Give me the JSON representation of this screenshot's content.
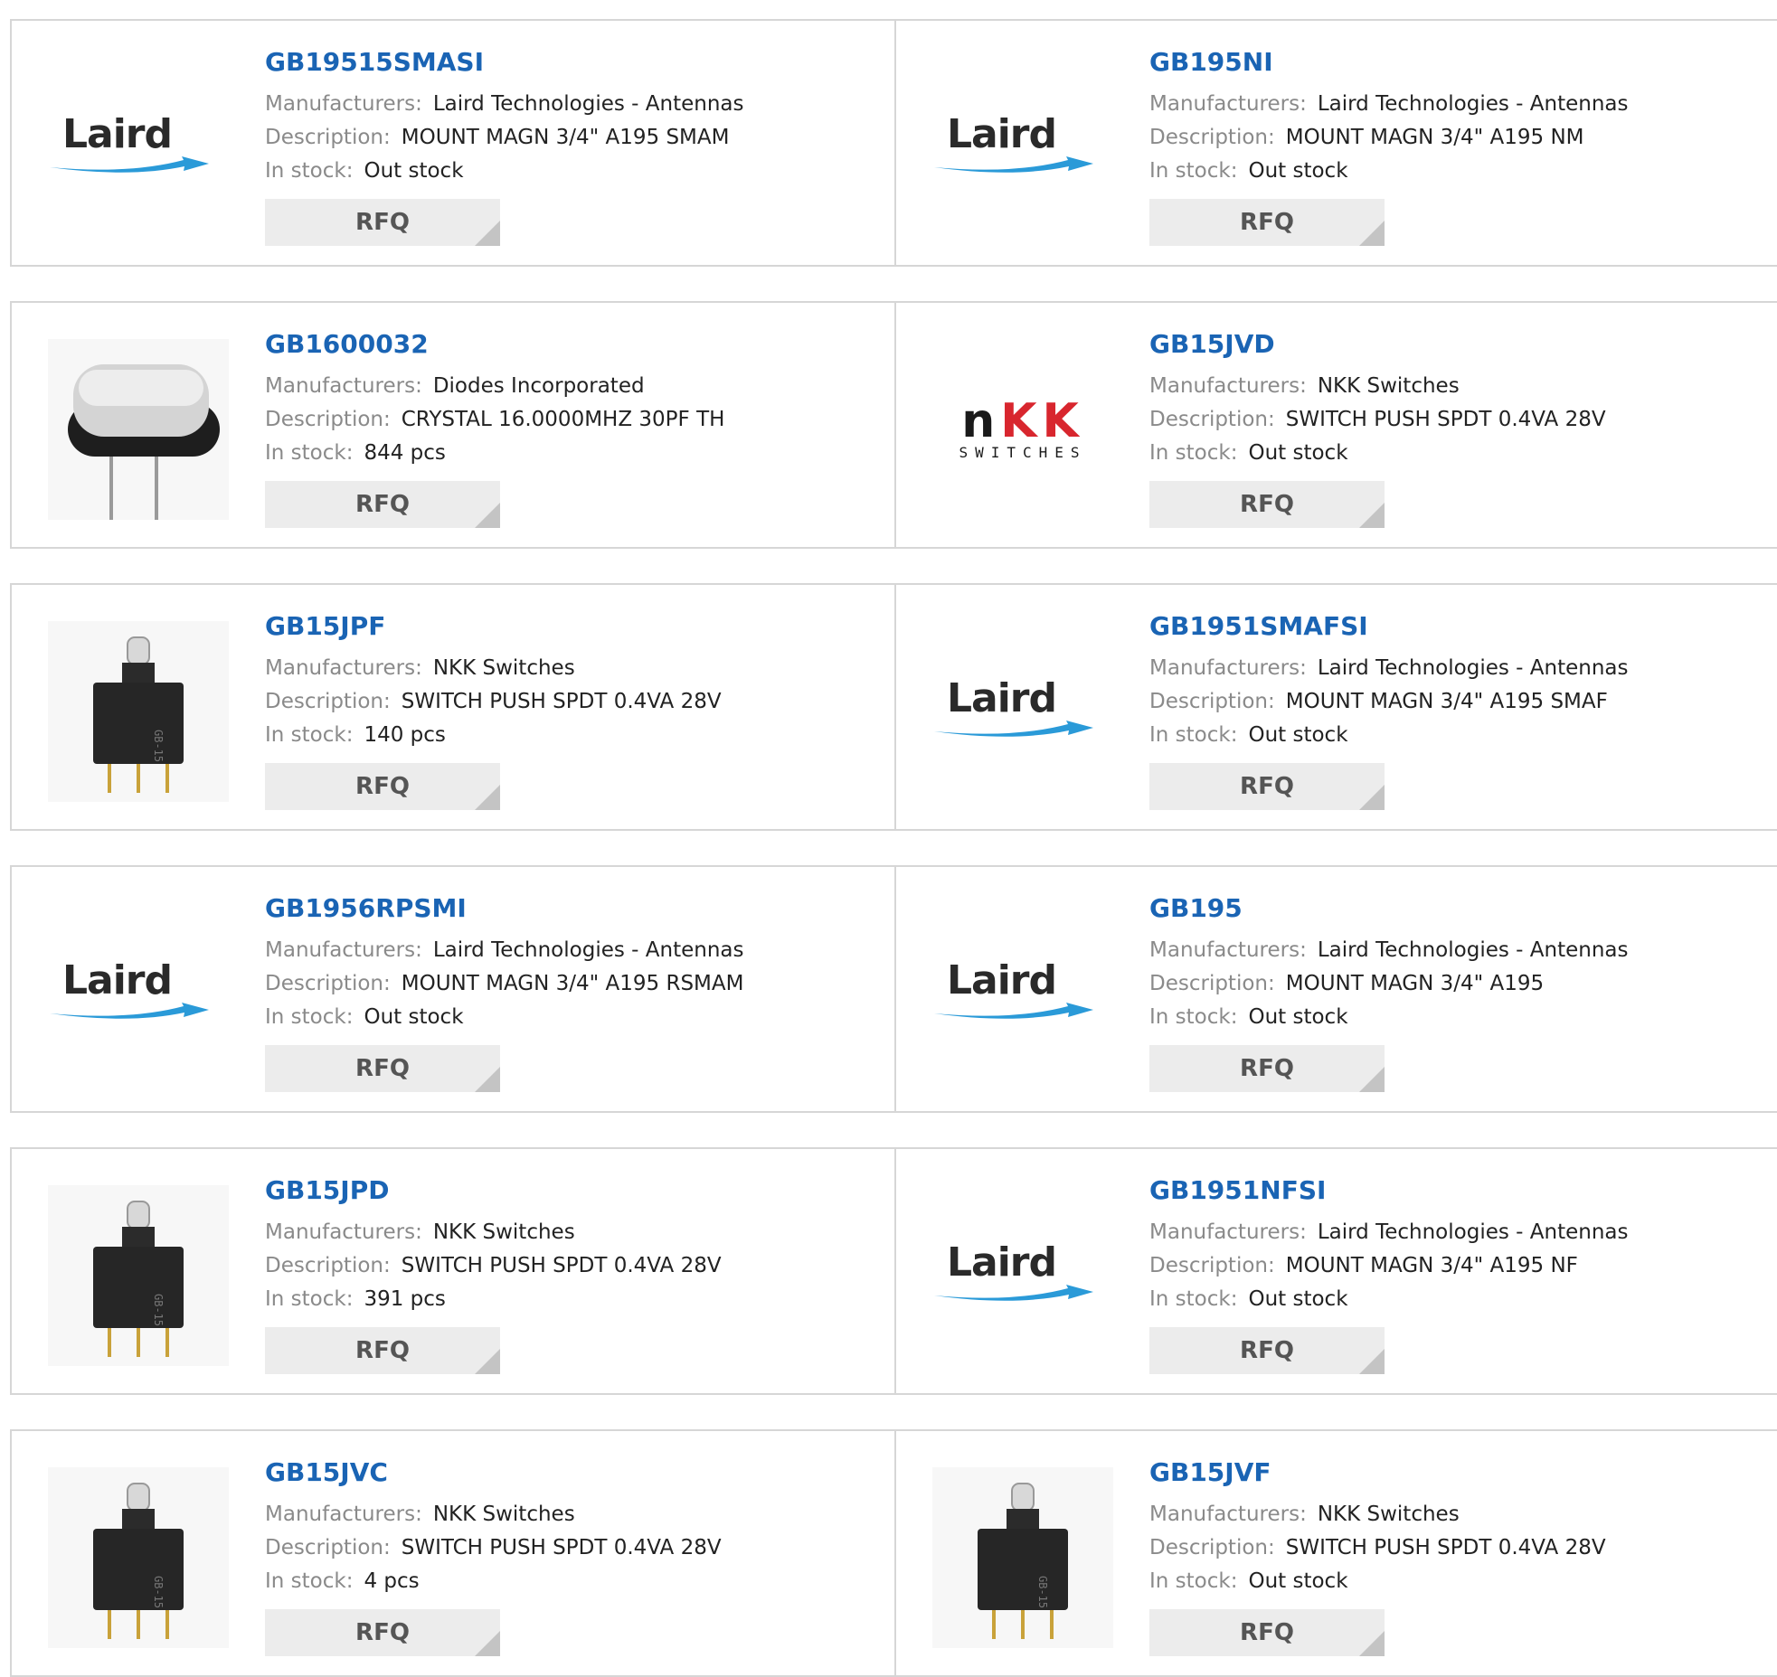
{
  "labels": {
    "manufacturers": "Manufacturers:",
    "description": "Description:",
    "in_stock": "In stock:",
    "rfq": "RFQ"
  },
  "logos": {
    "laird": "Laird",
    "nkk_mark_1": "n",
    "nkk_mark_2": "K",
    "nkk_mark_3": "K",
    "nkk_sub": "SWITCHES"
  },
  "products": [
    {
      "pn": "GB19515SMASI",
      "manufacturer": "Laird Technologies - Antennas",
      "description": "MOUNT MAGN 3/4\" A195 SMAM",
      "stock": "Out stock",
      "image": "laird-logo"
    },
    {
      "pn": "GB195NI",
      "manufacturer": "Laird Technologies - Antennas",
      "description": "MOUNT MAGN 3/4\" A195 NM",
      "stock": "Out stock",
      "image": "laird-logo"
    },
    {
      "pn": "GB1600032",
      "manufacturer": "Diodes Incorporated",
      "description": "CRYSTAL 16.0000MHZ 30PF TH",
      "stock": "844 pcs",
      "image": "crystal-photo"
    },
    {
      "pn": "GB15JVD",
      "manufacturer": "NKK Switches",
      "description": "SWITCH PUSH SPDT 0.4VA 28V",
      "stock": "Out stock",
      "image": "nkk-logo"
    },
    {
      "pn": "GB15JPF",
      "manufacturer": "NKK Switches",
      "description": "SWITCH PUSH SPDT 0.4VA 28V",
      "stock": "140 pcs",
      "image": "switch-photo"
    },
    {
      "pn": "GB1951SMAFSI",
      "manufacturer": "Laird Technologies - Antennas",
      "description": "MOUNT MAGN 3/4\" A195 SMAF",
      "stock": "Out stock",
      "image": "laird-logo"
    },
    {
      "pn": "GB1956RPSMI",
      "manufacturer": "Laird Technologies - Antennas",
      "description": "MOUNT MAGN 3/4\" A195 RSMAM",
      "stock": "Out stock",
      "image": "laird-logo"
    },
    {
      "pn": "GB195",
      "manufacturer": "Laird Technologies - Antennas",
      "description": "MOUNT MAGN 3/4\" A195",
      "stock": "Out stock",
      "image": "laird-logo"
    },
    {
      "pn": "GB15JPD",
      "manufacturer": "NKK Switches",
      "description": "SWITCH PUSH SPDT 0.4VA 28V",
      "stock": "391 pcs",
      "image": "switch-photo"
    },
    {
      "pn": "GB1951NFSI",
      "manufacturer": "Laird Technologies - Antennas",
      "description": "MOUNT MAGN 3/4\" A195 NF",
      "stock": "Out stock",
      "image": "laird-logo"
    },
    {
      "pn": "GB15JVC",
      "manufacturer": "NKK Switches",
      "description": "SWITCH PUSH SPDT 0.4VA 28V",
      "stock": "4 pcs",
      "image": "switch-photo"
    },
    {
      "pn": "GB15JVF",
      "manufacturer": "NKK Switches",
      "description": "SWITCH PUSH SPDT 0.4VA 28V",
      "stock": "Out stock",
      "image": "switch-photo"
    }
  ],
  "colors": {
    "part_number": "#1a64b4",
    "label": "#8a8a8a",
    "value": "#222222",
    "rfq_bg": "#ececec",
    "border": "#d6d6d6",
    "laird_swoosh": "#2a9ad8",
    "nkk_red": "#d8262e"
  }
}
